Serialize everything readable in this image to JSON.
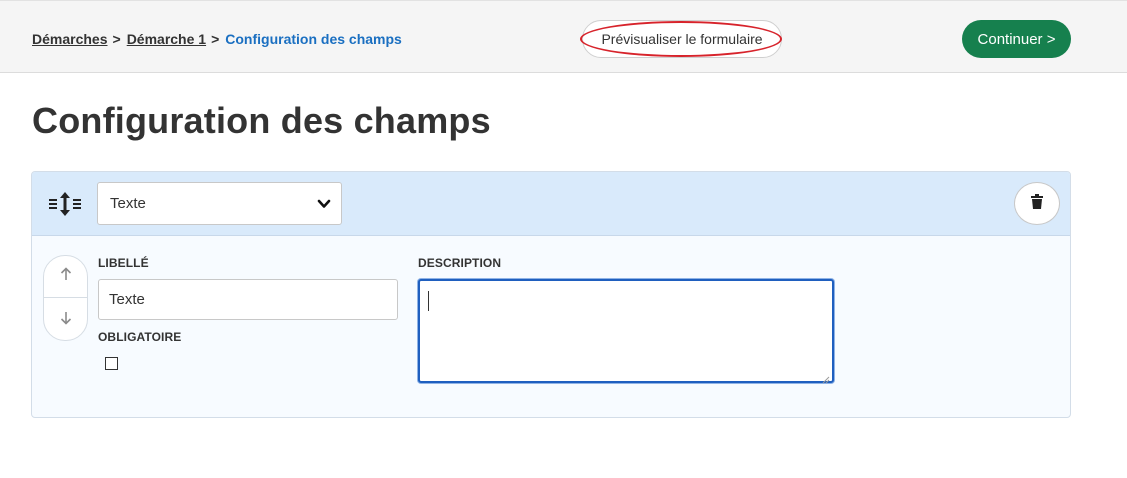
{
  "breadcrumb": {
    "items": [
      "Démarches",
      "Démarche 1"
    ],
    "separator": ">",
    "current": "Configuration des champs"
  },
  "header": {
    "preview_label": "Prévisualiser le formulaire",
    "continue_label": "Continuer >"
  },
  "page": {
    "title": "Configuration des champs"
  },
  "field": {
    "type_selected": "Texte",
    "libelle_label": "LIBELLÉ",
    "libelle_value": "Texte",
    "required_label": "OBLIGATOIRE",
    "required_checked": false,
    "description_label": "DESCRIPTION",
    "description_value": ""
  },
  "icons": {
    "drag": "drag-handle-icon",
    "chevron": "chevron-down-icon",
    "delete": "trash-icon",
    "up": "arrow-up-icon",
    "down": "arrow-down-icon"
  },
  "colors": {
    "accent": "#1a6fc1",
    "continue": "#16804e",
    "highlight_ring": "#d7232b",
    "card_header": "#d9eafb",
    "focus": "#1f5fbf"
  }
}
